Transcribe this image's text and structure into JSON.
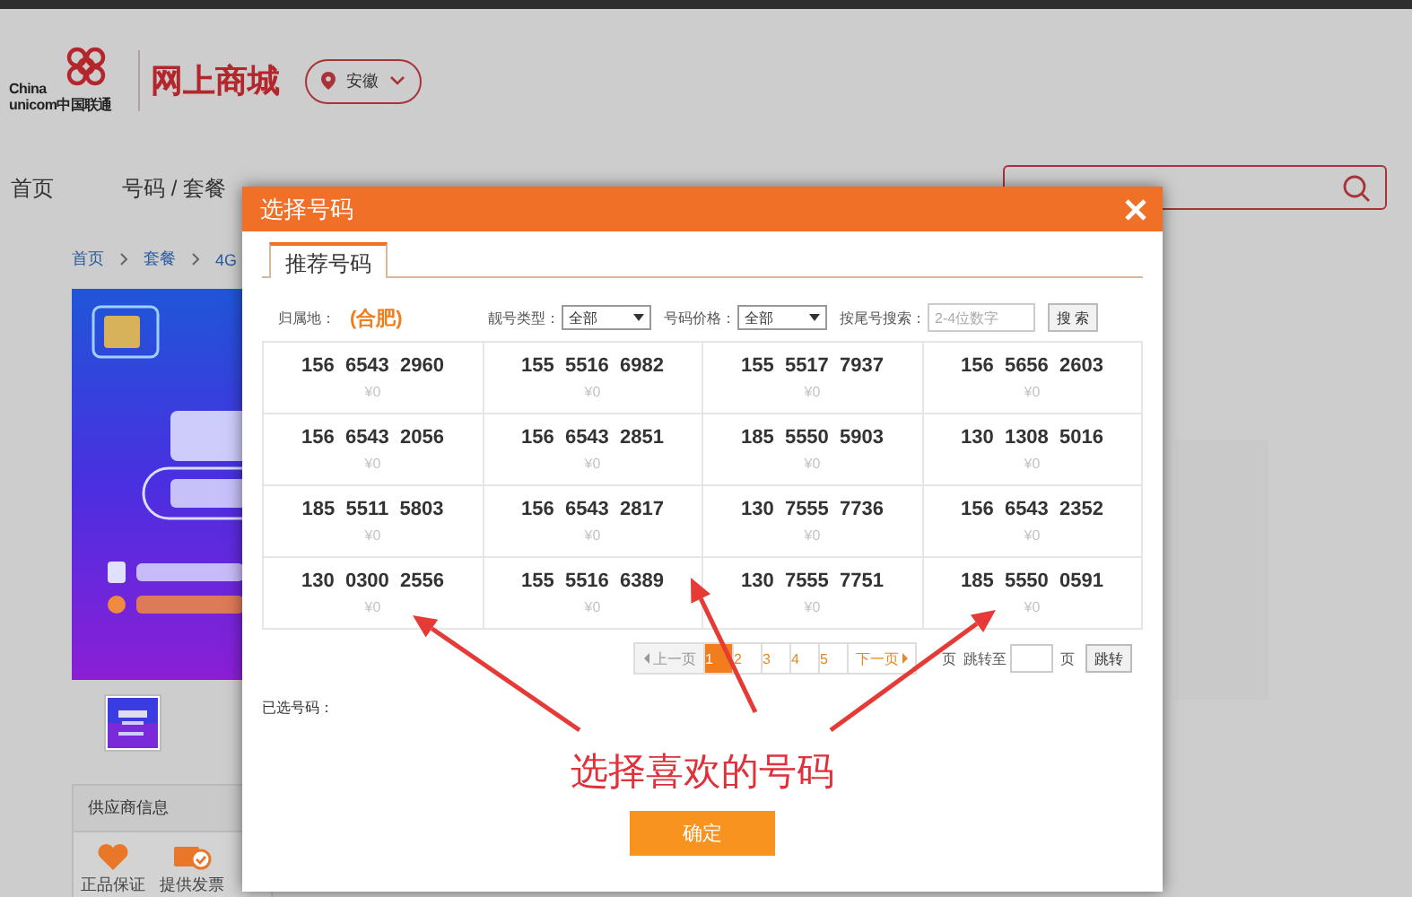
{
  "header": {
    "logo_lines": [
      "China",
      "unicom中国联通"
    ],
    "store_title": "网上商城",
    "location": "安徽"
  },
  "nav": [
    {
      "label": "首页"
    },
    {
      "label": "号码 / 套餐"
    }
  ],
  "breadcrumb": [
    "首页",
    "套餐",
    "4G"
  ],
  "supplier": {
    "title": "供应商信息",
    "badges": [
      "正品保证",
      "提供发票"
    ]
  },
  "dialog": {
    "title": "选择号码",
    "tabs": [
      {
        "label": "推荐号码",
        "selected": true
      }
    ],
    "filters": {
      "region_label": "归属地：",
      "region": "(合肥)",
      "type_label": "靓号类型：",
      "type_value": "全部",
      "price_label": "号码价格：",
      "price_value": "全部",
      "tail_label": "按尾号搜索：",
      "tail_placeholder": "2-4位数字",
      "search_button": "搜 索"
    },
    "numbers": [
      {
        "number": "156  6543  2960",
        "price": "¥0"
      },
      {
        "number": "155  5516  6982",
        "price": "¥0"
      },
      {
        "number": "155  5517  7937",
        "price": "¥0"
      },
      {
        "number": "156  5656  2603",
        "price": "¥0"
      },
      {
        "number": "156  6543  2056",
        "price": "¥0"
      },
      {
        "number": "156  6543  2851",
        "price": "¥0"
      },
      {
        "number": "185  5550  5903",
        "price": "¥0"
      },
      {
        "number": "130  1308  5016",
        "price": "¥0"
      },
      {
        "number": "185  5511  5803",
        "price": "¥0"
      },
      {
        "number": "156  6543  2817",
        "price": "¥0"
      },
      {
        "number": "130  7555  7736",
        "price": "¥0"
      },
      {
        "number": "156  6543  2352",
        "price": "¥0"
      },
      {
        "number": "130  0300  2556",
        "price": "¥0"
      },
      {
        "number": "155  5516  6389",
        "price": "¥0"
      },
      {
        "number": "130  7555  7751",
        "price": "¥0"
      },
      {
        "number": "185  5550  0591",
        "price": "¥0"
      }
    ],
    "pagination": {
      "prev": "上一页",
      "pages": [
        {
          "label": "1",
          "selected": true
        },
        {
          "label": "2",
          "selected": false
        },
        {
          "label": "3",
          "selected": false
        },
        {
          "label": "4",
          "selected": false
        },
        {
          "label": "5",
          "selected": false
        }
      ],
      "next": "下一页",
      "total": "页",
      "goto_label": "跳转至",
      "page_unit": "页",
      "goto_button": "跳转"
    },
    "selected_label": "已选号码：",
    "annotation": "选择喜欢的号码",
    "confirm": "确定"
  }
}
